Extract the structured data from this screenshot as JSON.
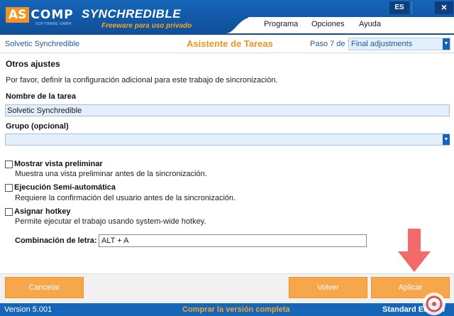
{
  "header": {
    "logo_box": "AS",
    "logo_rest": "COMP",
    "logo_sub": "SOFTWARE GMBH",
    "app_title": "SYNCHREDIBLE",
    "app_subtitle": "Freeware para uso privado",
    "language_button": "ES",
    "close_button": "×"
  },
  "menu": {
    "items": [
      {
        "label": "Programa"
      },
      {
        "label": "Opciones"
      },
      {
        "label": "Ayuda"
      }
    ]
  },
  "info": {
    "task_name": "Solvetic Synchredible",
    "wizard_title": "Asistente de Tareas",
    "step_label": "Paso 7 de 7:",
    "step_value": "Final adjustments"
  },
  "content": {
    "section_title": "Otros ajustes",
    "section_desc": "Por favor, definir la configuración adicional para este trabajo de sincronización.",
    "task_name_label": "Nombre de la tarea",
    "task_name_value": "Solvetic Synchredible",
    "group_label": "Grupo (opcional)",
    "group_value": "",
    "options": [
      {
        "label": "Mostrar vista preliminar",
        "desc": "Muestra una vista preliminar antes de la sincronización.",
        "checked": false
      },
      {
        "label": "Ejecución Semi-automática",
        "desc": "Requiere la confirmación del usuario antes de la sincronización.",
        "checked": false
      },
      {
        "label": "Asignar hotkey",
        "desc": "Permite ejecutar el trabajo usando system-wide hotkey.",
        "checked": false
      }
    ],
    "combo_label": "Combinación de letra:",
    "combo_value": "ALT + A"
  },
  "buttons": {
    "cancel": "Cancelar",
    "back": "Volver",
    "apply": "Aplicar"
  },
  "status": {
    "version": "Version 5.001",
    "buy": "Comprar la versión completa",
    "edition": "Standard Edition"
  },
  "colors": {
    "brand_blue": "#1565b8",
    "accent_orange": "#f39325",
    "button_orange": "#f6a64b",
    "arrow_red": "#f26a6a"
  }
}
